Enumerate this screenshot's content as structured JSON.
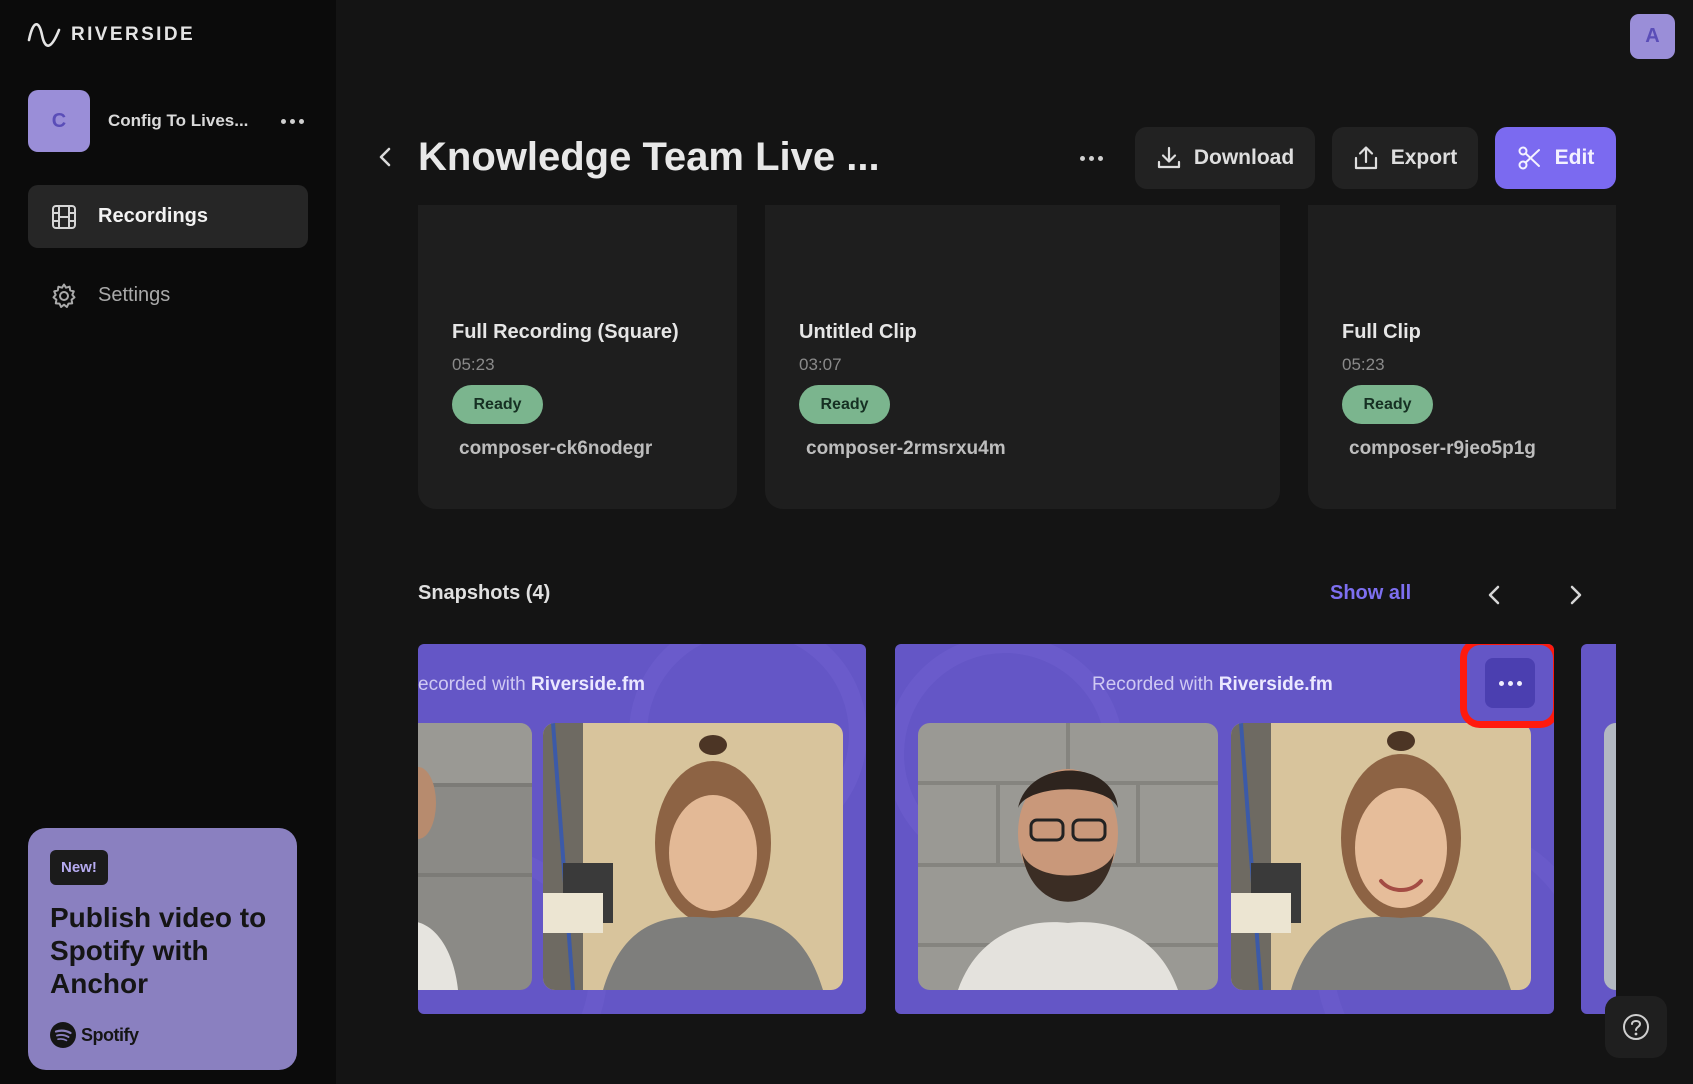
{
  "app": {
    "brand": "RIVERSIDE",
    "user_initial": "A"
  },
  "workspace": {
    "initial": "C",
    "name": "Config To Lives..."
  },
  "sidebar": {
    "items": [
      {
        "label": "Recordings",
        "icon": "film-icon",
        "active": true
      },
      {
        "label": "Settings",
        "icon": "gear-icon",
        "active": false
      }
    ]
  },
  "promo": {
    "badge": "New!",
    "title": "Publish video to Spotify with Anchor",
    "brand": "Spotify"
  },
  "header": {
    "title": "Knowledge Team Live ...",
    "download_label": "Download",
    "export_label": "Export",
    "edit_label": "Edit"
  },
  "clips": [
    {
      "title": "Full Recording (Square)",
      "duration": "05:23",
      "status": "Ready",
      "id": "composer-ck6nodegr"
    },
    {
      "title": "Untitled Clip",
      "duration": "03:07",
      "status": "Ready",
      "id": "composer-2rmsrxu4m"
    },
    {
      "title": "Full Clip",
      "duration": "05:23",
      "status": "Ready",
      "id": "composer-r9jeo5p1g"
    }
  ],
  "snapshots": {
    "heading": "Snapshots (4)",
    "show_all": "Show all",
    "watermark_prefix": "Recorded with ",
    "watermark_prefix_cropped": "ecorded with ",
    "watermark_brand": "Riverside.fm"
  },
  "colors": {
    "accent": "#7b6af0",
    "ready_badge": "#7bb58e",
    "snapshot_bg": "#6456c6",
    "highlight": "#ff1a0e"
  }
}
